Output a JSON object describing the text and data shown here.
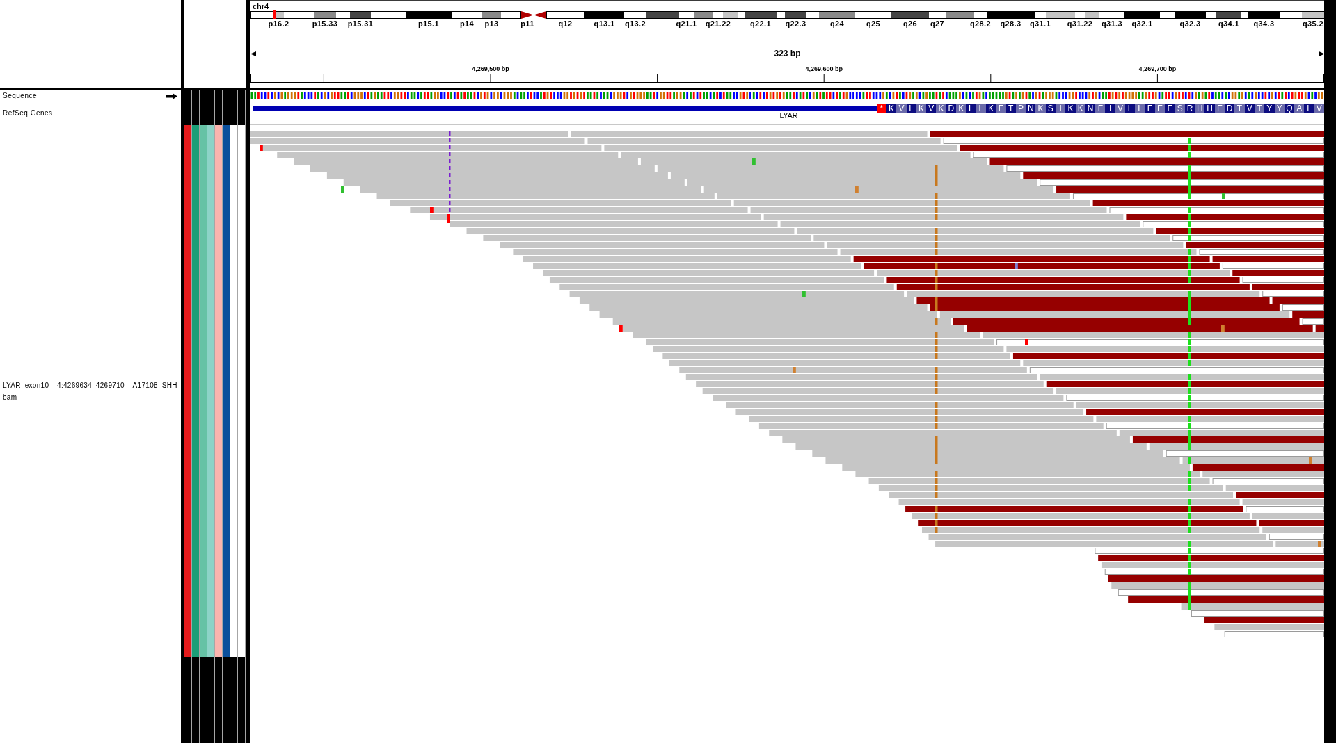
{
  "ideogram": {
    "chromosome": "chr4",
    "bands": [
      {
        "kind": "gneg",
        "current": false
      },
      {
        "label": "p16.2",
        "kind": "gpos25",
        "current": true
      },
      {
        "kind": "gneg",
        "current": false
      },
      {
        "label": "p15.33",
        "kind": "gpos50",
        "current": false
      },
      {
        "kind": "gneg",
        "current": false
      },
      {
        "label": "p15.31",
        "kind": "gpos75",
        "current": false
      },
      {
        "kind": "gneg",
        "current": false
      },
      {
        "label": "p15.1",
        "kind": "gpos100",
        "current": false
      },
      {
        "label": "p14",
        "kind": "gneg",
        "current": false
      },
      {
        "label": "p13",
        "kind": "gpos50",
        "current": false
      },
      {
        "kind": "gneg",
        "current": false
      },
      {
        "label": "p11",
        "kind": "acen",
        "current": false
      },
      {
        "kind": "acen",
        "current": false
      },
      {
        "label": "q12",
        "kind": "gneg",
        "current": false
      },
      {
        "label": "q13.1",
        "kind": "gpos100",
        "current": false
      },
      {
        "label": "q13.2",
        "kind": "gneg",
        "current": false
      },
      {
        "kind": "gpos75",
        "current": false
      },
      {
        "label": "q21.1",
        "kind": "gneg",
        "current": false
      },
      {
        "kind": "gpos50",
        "current": false
      },
      {
        "label": "q21.22",
        "kind": "gneg",
        "current": false
      },
      {
        "kind": "gpos25",
        "current": false
      },
      {
        "kind": "gneg",
        "current": false
      },
      {
        "label": "q22.1",
        "kind": "gpos75",
        "current": false
      },
      {
        "kind": "gneg",
        "current": false
      },
      {
        "label": "q22.3",
        "kind": "gpos75",
        "current": false
      },
      {
        "kind": "gneg",
        "current": false
      },
      {
        "label": "q24",
        "kind": "gpos50",
        "current": false
      },
      {
        "label": "q25",
        "kind": "gneg",
        "current": false
      },
      {
        "label": "q26",
        "kind": "gpos75",
        "current": false
      },
      {
        "label": "q27",
        "kind": "gneg",
        "current": false
      },
      {
        "kind": "gpos50",
        "current": false
      },
      {
        "label": "q28.2",
        "kind": "gneg",
        "current": false
      },
      {
        "label": "q28.3",
        "kind": "gpos100",
        "current": false
      },
      {
        "label": "q31.1",
        "kind": "gneg",
        "current": false
      },
      {
        "kind": "gpos25",
        "current": false
      },
      {
        "label": "q31.22",
        "kind": "gneg",
        "current": false
      },
      {
        "kind": "gpos25",
        "current": false
      },
      {
        "label": "q31.3",
        "kind": "gneg",
        "current": false
      },
      {
        "label": "q32.1",
        "kind": "gpos100",
        "current": false
      },
      {
        "kind": "gneg",
        "current": false
      },
      {
        "label": "q32.3",
        "kind": "gpos100",
        "current": false
      },
      {
        "kind": "gneg",
        "current": false
      },
      {
        "label": "q34.1",
        "kind": "gpos75",
        "current": false
      },
      {
        "kind": "gneg",
        "current": false
      },
      {
        "label": "q34.3",
        "kind": "gpos100",
        "current": false
      },
      {
        "kind": "gneg",
        "current": false
      },
      {
        "label": "q35.2",
        "kind": "gpos25",
        "current": false
      }
    ]
  },
  "ruler": {
    "span": "323 bp",
    "tick_labels": [
      "4,269,500 bp",
      "4,269,600 bp",
      "4,269,700 bp"
    ]
  },
  "tracks": [
    {
      "kind": "sequence",
      "name": "Sequence"
    },
    {
      "kind": "genes",
      "name": "RefSeq Genes",
      "gene": {
        "name": "LYAR",
        "stop_codon": "*",
        "amino_acids": [
          "K",
          "V",
          "L",
          "K",
          "V",
          "K",
          "D",
          "K",
          "L",
          "L",
          "K",
          "F",
          "T",
          "P",
          "N",
          "K",
          "S",
          "I",
          "K",
          "K",
          "N",
          "F",
          "I",
          "V",
          "L",
          "L",
          "E",
          "E",
          "E",
          "S",
          "R",
          "H",
          "H",
          "E",
          "D",
          "T",
          "V",
          "T",
          "Y",
          "Y",
          "Q",
          "A",
          "L",
          "V"
        ]
      }
    },
    {
      "kind": "alignments",
      "name_lines": [
        "LYAR_exon10__4:4269634_4269710__A17108_SHH",
        "bam"
      ],
      "attributes": [
        {
          "color": "#e41a1c"
        },
        {
          "color": "#1b9e77"
        },
        {
          "color": "#66c2a5"
        },
        {
          "color": "#8dd3c7"
        },
        {
          "color": "#fbb4ae"
        },
        {
          "color": "#0b4f9c"
        },
        {
          "color": "#ffffff"
        },
        {
          "color": "#ffffff"
        }
      ]
    }
  ]
}
